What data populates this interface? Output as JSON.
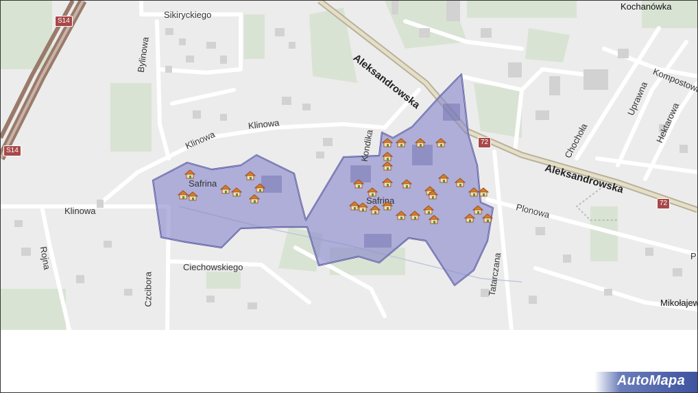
{
  "streets": {
    "sikiryckiego": "Sikiryckiego",
    "bylinowa": "Bylinowa",
    "klinowa_upper": "Klinowa",
    "klinowa_mid": "Klinowa",
    "klinowa_left": "Klinowa",
    "rojna": "Rojna",
    "ciechowskiego": "Ciechowskiego",
    "czcibora": "Czcibora",
    "safrina_west": "Safrina",
    "safrina_east": "Safrina",
    "kondika": "Kondika",
    "aleksandrowska_top": "Aleksandrowska",
    "aleksandrowska_bottom": "Aleksandrowska",
    "plonowa": "Plonowa",
    "tatarczana": "Tatarczana",
    "chochola": "Chochoła",
    "uprawna": "Uprawna",
    "hektarowa": "Hektarowa",
    "kompostowa": "Kompostowa",
    "p_cut": "P"
  },
  "places": {
    "kochanowka": "Kochanówka",
    "mikolajew": "Mikołajew"
  },
  "road_shields": {
    "s14_top": "S14",
    "s14_bottom": "S14",
    "r72_top": "72",
    "r72_bottom": "72"
  },
  "branding": {
    "logo": "AutoMapa"
  },
  "colors": {
    "area_fill": "#8888cc",
    "area_stroke": "#4a4a9a",
    "road_shield": "#a84848",
    "logo_bg": "#5a6fb0"
  },
  "icons": [
    "house-icon"
  ]
}
